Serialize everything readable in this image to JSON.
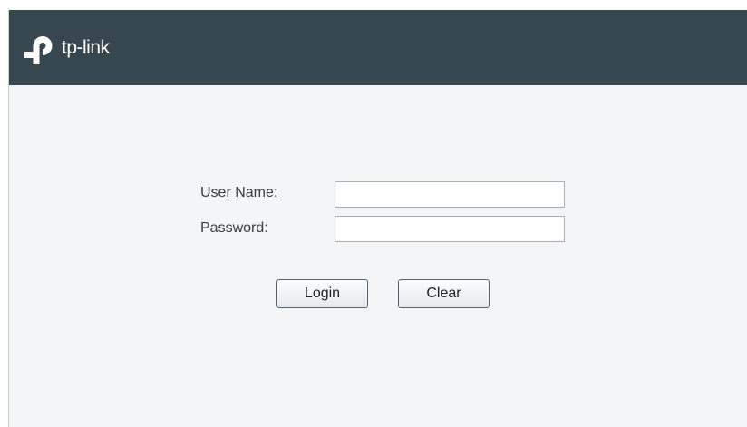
{
  "header": {
    "brand": "tp-link",
    "logo_icon": "tp-link-logo-icon",
    "background_color": "#37474f"
  },
  "login_form": {
    "username_label": "User Name:",
    "username_value": "",
    "password_label": "Password:",
    "password_value": "",
    "login_label": "Login",
    "clear_label": "Clear"
  }
}
